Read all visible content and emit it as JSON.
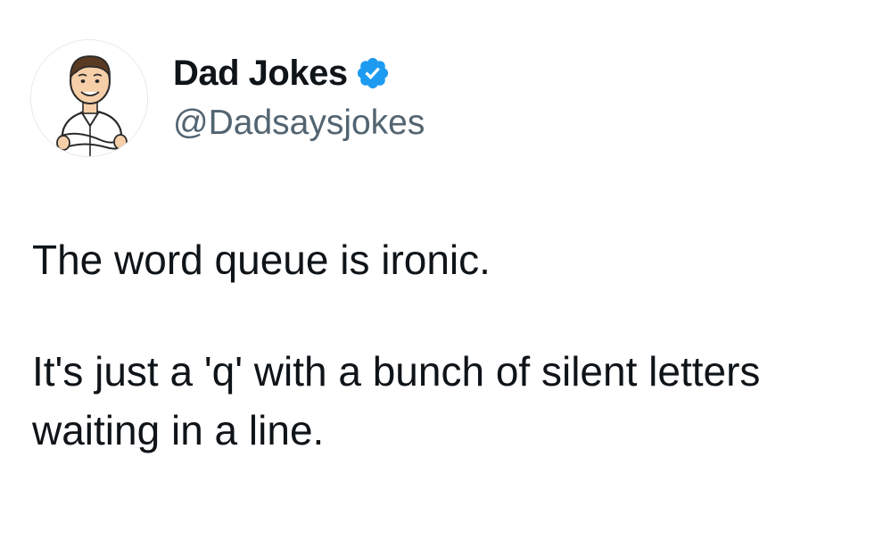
{
  "tweet": {
    "author": {
      "display_name": "Dad Jokes",
      "handle": "@Dadsaysjokes",
      "verified": true,
      "avatar_icon": "cartoon-man-arms-crossed",
      "verified_icon": "verified-badge-icon",
      "verified_color": "#1d9bf0"
    },
    "text": {
      "paragraph_1": "The word queue is ironic.",
      "paragraph_2": "It's just a 'q' with a bunch of silent letters waiting in a line."
    }
  }
}
